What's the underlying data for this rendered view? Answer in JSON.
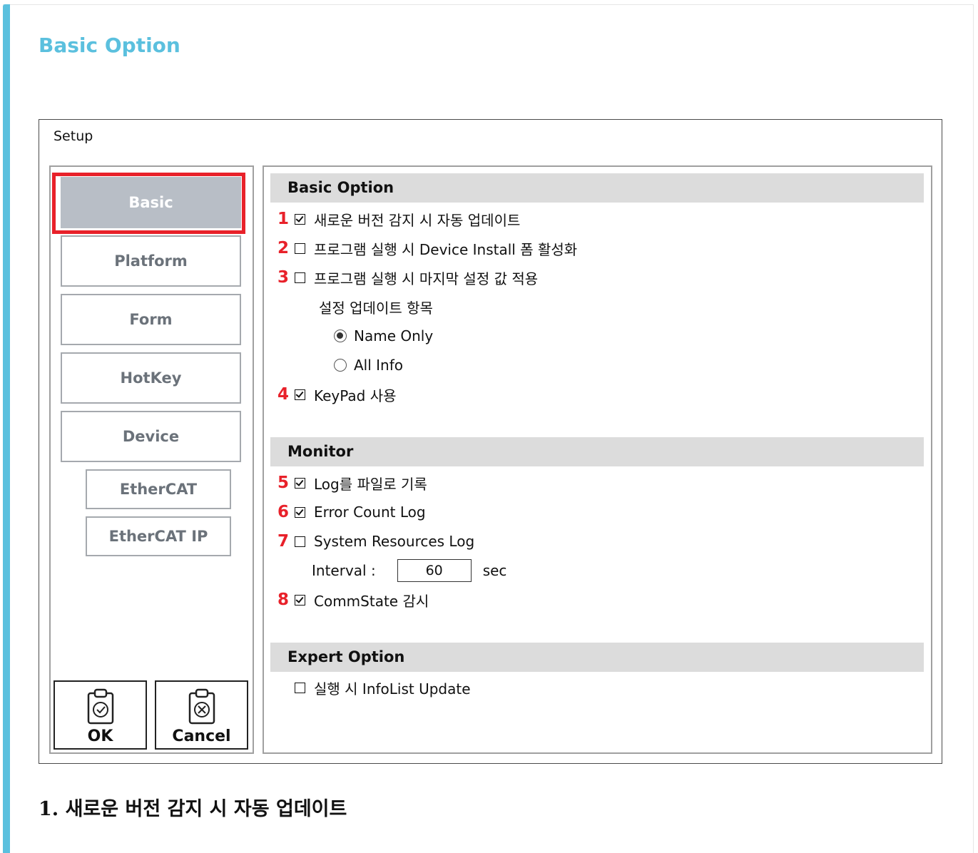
{
  "doc": {
    "heading": "Basic Option",
    "caption": "1. 새로운 버전 감지 시 자동 업데이트",
    "accent_color": "#5bc0de",
    "highlight_color": "#e8212a"
  },
  "dialog": {
    "title": "Setup",
    "nav": {
      "basic": "Basic",
      "platform": "Platform",
      "form": "Form",
      "hotkey": "HotKey",
      "device": "Device",
      "ethercat": "EtherCAT",
      "ethercat_ip": "EtherCAT IP"
    },
    "ok_label": "OK",
    "cancel_label": "Cancel"
  },
  "basic_option": {
    "header": "Basic Option",
    "items": [
      {
        "num": "1",
        "label": "새로운 버전 감지 시 자동 업데이트",
        "checked": true
      },
      {
        "num": "2",
        "label": "프로그램 실행 시 Device Install 폼 활성화",
        "checked": false
      },
      {
        "num": "3",
        "label": "프로그램 실행 시 마지막 설정 값 적용",
        "checked": false
      },
      {
        "num": "4",
        "label": "KeyPad 사용",
        "checked": true
      }
    ],
    "update_items_label": "설정 업데이트 항목",
    "radio_name_only": "Name Only",
    "radio_all_info": "All Info",
    "selected_radio": "Name Only"
  },
  "monitor": {
    "header": "Monitor",
    "items": [
      {
        "num": "5",
        "label": "Log를 파일로 기록",
        "checked": true
      },
      {
        "num": "6",
        "label": "Error Count Log",
        "checked": true
      },
      {
        "num": "7",
        "label": "System Resources Log",
        "checked": false
      },
      {
        "num": "8",
        "label": "CommState 감시",
        "checked": true
      }
    ],
    "interval_label": "Interval :",
    "interval_value": "60",
    "interval_unit": "sec"
  },
  "expert_option": {
    "header": "Expert Option",
    "item_label": "실행 시 InfoList Update",
    "checked": false
  }
}
